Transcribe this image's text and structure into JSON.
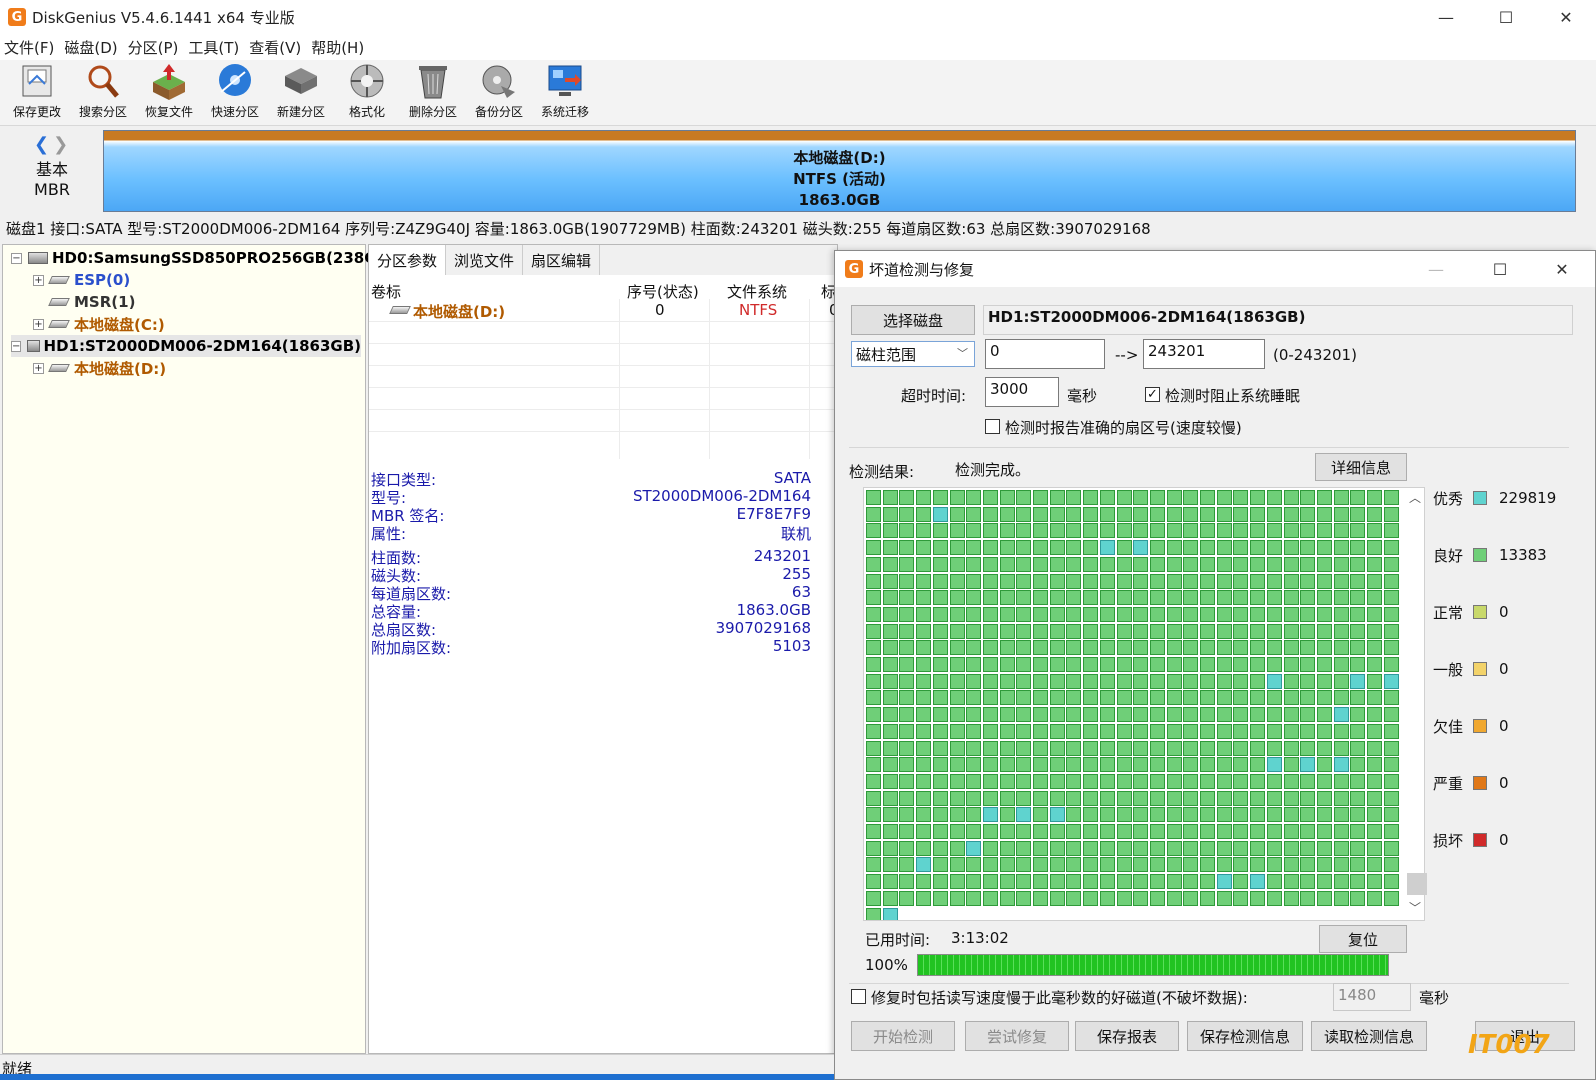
{
  "window": {
    "title": "DiskGenius V5.4.6.1441 x64 专业版",
    "logo": "G",
    "minimize": "—",
    "maximize": "☐",
    "close": "✕"
  },
  "menu": [
    "文件(F)",
    "磁盘(D)",
    "分区(P)",
    "工具(T)",
    "查看(V)",
    "帮助(H)"
  ],
  "toolbar": [
    {
      "label": "保存更改",
      "icon": "save-icon"
    },
    {
      "label": "搜索分区",
      "icon": "search-icon"
    },
    {
      "label": "恢复文件",
      "icon": "restore-file-icon"
    },
    {
      "label": "快速分区",
      "icon": "quick-partition-icon"
    },
    {
      "label": "新建分区",
      "icon": "new-partition-icon"
    },
    {
      "label": "格式化",
      "icon": "format-icon"
    },
    {
      "label": "删除分区",
      "icon": "delete-partition-icon"
    },
    {
      "label": "备份分区",
      "icon": "backup-partition-icon"
    },
    {
      "label": "系统迁移",
      "icon": "system-migrate-icon"
    }
  ],
  "diskmap": {
    "kind": "基本",
    "scheme": "MBR",
    "partition": {
      "name": "本地磁盘(D:)",
      "fs": "NTFS (活动)",
      "size": "1863.0GB"
    }
  },
  "diskinfo": "磁盘1 接口:SATA  型号:ST2000DM006-2DM164  序列号:Z4Z9G40J  容量:1863.0GB(1907729MB)  柱面数:243201  磁头数:255  每道扇区数:63  总扇区数:3907029168",
  "tree": [
    {
      "label": "HD0:SamsungSSD850PRO256GB(238GB)",
      "kind": "disk"
    },
    {
      "label": "ESP(0)",
      "kind": "part-blue"
    },
    {
      "label": "MSR(1)",
      "kind": "part-gray"
    },
    {
      "label": "本地磁盘(C:)",
      "kind": "part-orange"
    },
    {
      "label": "HD1:ST2000DM006-2DM164(1863GB)",
      "kind": "disk"
    },
    {
      "label": "本地磁盘(D:)",
      "kind": "part-orange"
    }
  ],
  "tabs": [
    "分区参数",
    "浏览文件",
    "扇区编辑"
  ],
  "partition_table": {
    "headers": [
      "卷标",
      "序号(状态)",
      "文件系统",
      "标"
    ],
    "rows": [
      {
        "label": "本地磁盘(D:)",
        "index": "0",
        "fs": "NTFS",
        "flag": "0"
      }
    ]
  },
  "disk_props": [
    {
      "k": "接口类型:",
      "v": "SATA"
    },
    {
      "k": "型号:",
      "v": "ST2000DM006-2DM164"
    },
    {
      "k": "MBR 签名:",
      "v": "E7F8E7F9"
    },
    {
      "k": "属性:",
      "v": "联机"
    },
    {
      "k": "柱面数:",
      "v": "243201"
    },
    {
      "k": "磁头数:",
      "v": "255"
    },
    {
      "k": "每道扇区数:",
      "v": "63"
    },
    {
      "k": "总容量:",
      "v": "1863.0GB"
    },
    {
      "k": "总扇区数:",
      "v": "3907029168"
    },
    {
      "k": "附加扇区数:",
      "v": "5103"
    }
  ],
  "dialog": {
    "title": "坏道检测与修复",
    "select_disk_btn": "选择磁盘",
    "disk_name": "HD1:ST2000DM006-2DM164(1863GB)",
    "range_mode": "磁柱范围",
    "range_start": "0",
    "range_arrow": "-->",
    "range_end": "243201",
    "range_hint": "(0-243201)",
    "timeout_label": "超时时间:",
    "timeout_value": "3000",
    "timeout_unit": "毫秒",
    "prevent_sleep": "检测时阻止系统睡眠",
    "prevent_sleep_checked": true,
    "report_sector": "检测时报告准确的扇区号(速度较慢)",
    "report_sector_checked": false,
    "result_label": "检测结果:",
    "result_value": "检测完成。",
    "detail_btn": "详细信息",
    "legend": [
      {
        "name": "优秀",
        "count": "229819",
        "color": "#5fd3cf"
      },
      {
        "name": "良好",
        "count": "13383",
        "color": "#6fcf78"
      },
      {
        "name": "正常",
        "count": "0",
        "color": "#c8d86a"
      },
      {
        "name": "一般",
        "count": "0",
        "color": "#f3d36a"
      },
      {
        "name": "欠佳",
        "count": "0",
        "color": "#f0a830"
      },
      {
        "name": "严重",
        "count": "0",
        "color": "#e07818"
      },
      {
        "name": "损坏",
        "count": "0",
        "color": "#d02a2a"
      }
    ],
    "elapsed_label": "已用时间:",
    "elapsed_value": "3:13:02",
    "reset_btn": "复位",
    "progress_text": "100%",
    "progress": 1.0,
    "repair_option": "修复时包括读写速度慢于此毫秒数的好磁道(不破坏数据):",
    "repair_ms": "1480",
    "repair_unit": "毫秒",
    "buttons": {
      "start": "开始检测",
      "try_repair": "尝试修复",
      "save_report": "保存报表",
      "save_info": "保存检测信息",
      "load_info": "读取检测信息",
      "exit": "退出"
    }
  },
  "status": "就绪",
  "watermark": "IT007"
}
